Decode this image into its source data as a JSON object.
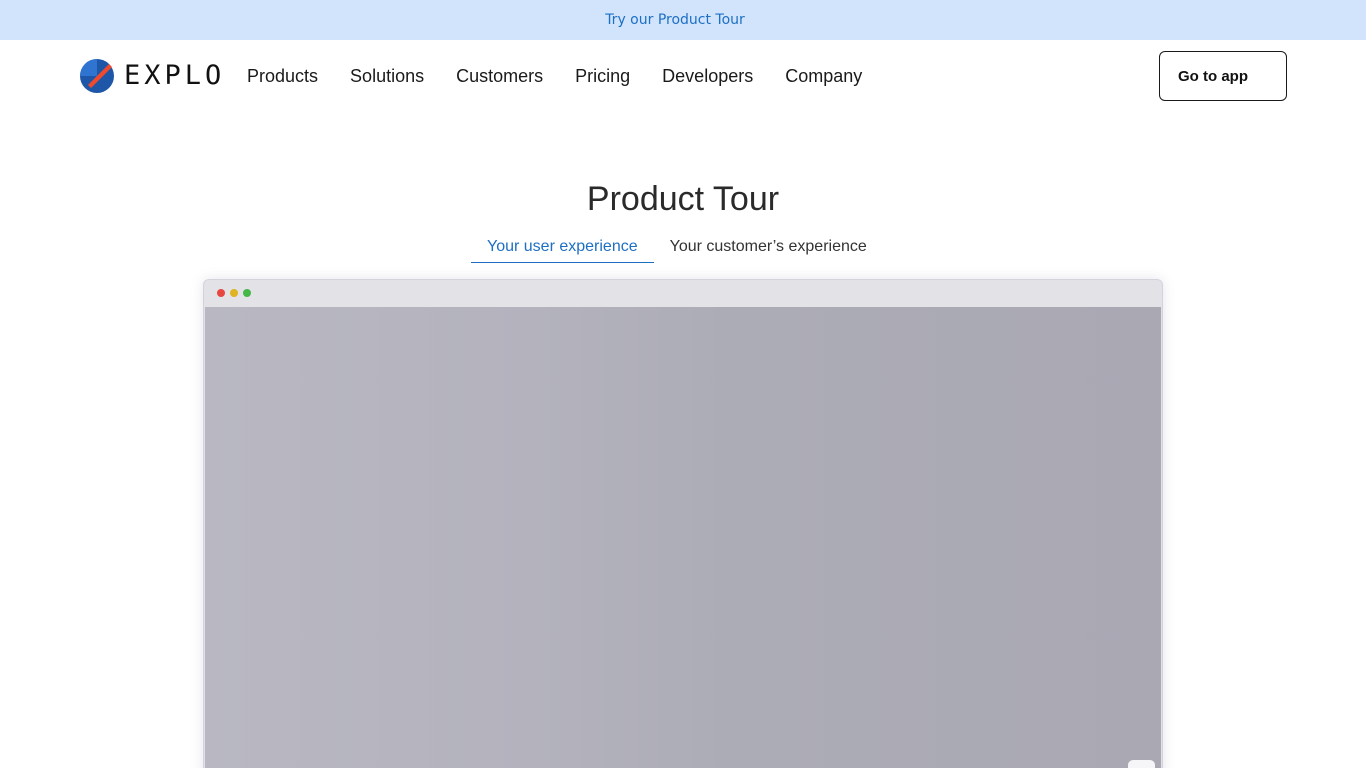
{
  "promo": {
    "text": "Try our Product Tour"
  },
  "header": {
    "logo_text": "EXPLO",
    "nav": [
      "Products",
      "Solutions",
      "Customers",
      "Pricing",
      "Developers",
      "Company"
    ],
    "cta_label": "Go to app"
  },
  "main": {
    "title": "Product Tour",
    "tabs": [
      {
        "label": "Your user experience",
        "active": true
      },
      {
        "label": "Your customer’s experience",
        "active": false
      }
    ]
  },
  "colors": {
    "promo_bg": "#d1e4fc",
    "accent": "#1d6fc4",
    "logo_blue": "#1f57a8",
    "logo_red": "#f04a2e"
  },
  "icons": [
    "explo-logo-icon",
    "window-close-dot-icon",
    "window-minimize-dot-icon",
    "window-maximize-dot-icon"
  ]
}
